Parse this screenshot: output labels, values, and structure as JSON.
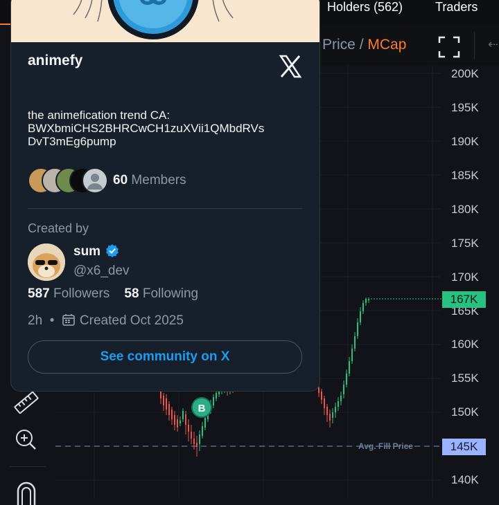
{
  "tabs": {
    "holders": "Holders (562)",
    "traders": "Traders"
  },
  "chart_toolbar": {
    "price_label": "Price",
    "separator": "/",
    "mcap_label": "MCap"
  },
  "community": {
    "name": "animefy",
    "description_lines": [
      "the animefication trend CA:",
      "BWXbmiCHS2BHRCwCH1zuXVii1QMbdRVs",
      "DvT3mEg6pump"
    ],
    "members_count": "60",
    "members_label": "Members",
    "created_by_label": "Created by",
    "creator": {
      "name": "sum",
      "handle": "@x6_dev",
      "verified": true
    },
    "followers_count": "587",
    "followers_label": "Followers",
    "following_count": "58",
    "following_label": "Following",
    "age": "2h",
    "dot": "•",
    "created_date": "Created Oct 2025",
    "cta": "See community on X"
  },
  "chart": {
    "y_axis": [
      "200K",
      "195K",
      "190K",
      "185K",
      "180K",
      "175K",
      "170K",
      "165K",
      "160K",
      "155K",
      "150K",
      "145K",
      "140K"
    ],
    "current_price_tag": "167K",
    "avg_fill_tag": "145K",
    "avg_fill_label": "Avg. Fill Price",
    "buy_marker": "B",
    "up_color": "#26c281",
    "down_color": "#ef5350"
  }
}
